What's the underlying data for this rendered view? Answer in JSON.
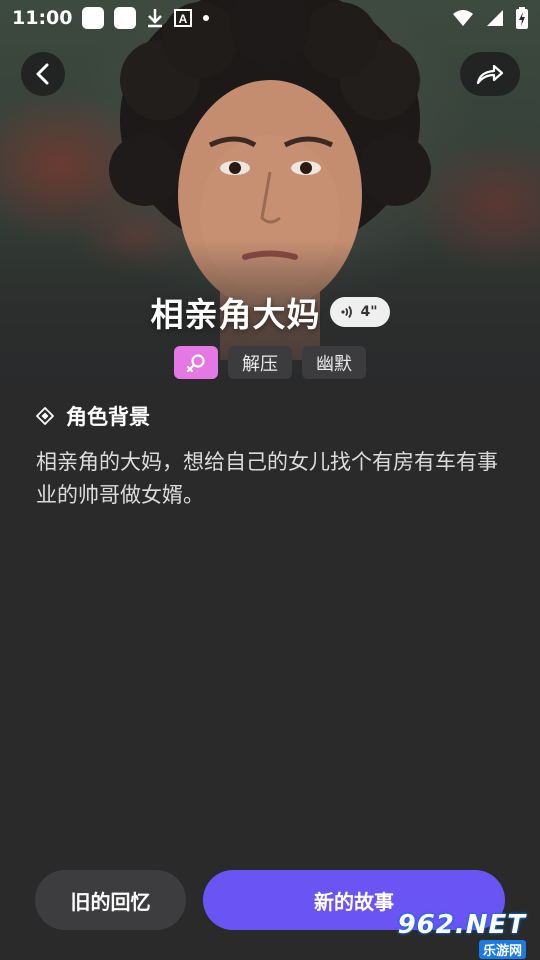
{
  "status_bar": {
    "time": "11:00",
    "icons": [
      "app-icon",
      "app-icon",
      "download-icon",
      "font-icon",
      "dot-icon",
      "wifi-icon",
      "signal-icon",
      "battery-charging-icon"
    ]
  },
  "header": {
    "back_icon": "chevron-left-icon",
    "share_icon": "share-arrow-icon"
  },
  "character": {
    "name": "相亲角大妈",
    "voice_duration": "4\"",
    "tags": [
      "解压",
      "幽默"
    ],
    "gender_icon": "female-icon",
    "gender_color": "#e478e4"
  },
  "background_section": {
    "title": "角色背景",
    "description": "相亲角的大妈，想给自己的女儿找个有房有车有事业的帅哥做女婿。"
  },
  "actions": {
    "old_memory_label": "旧的回忆",
    "new_story_label": "新的故事",
    "accent": "#6a55f4"
  },
  "watermark": {
    "main": "962.NET",
    "sub": "乐游网"
  }
}
